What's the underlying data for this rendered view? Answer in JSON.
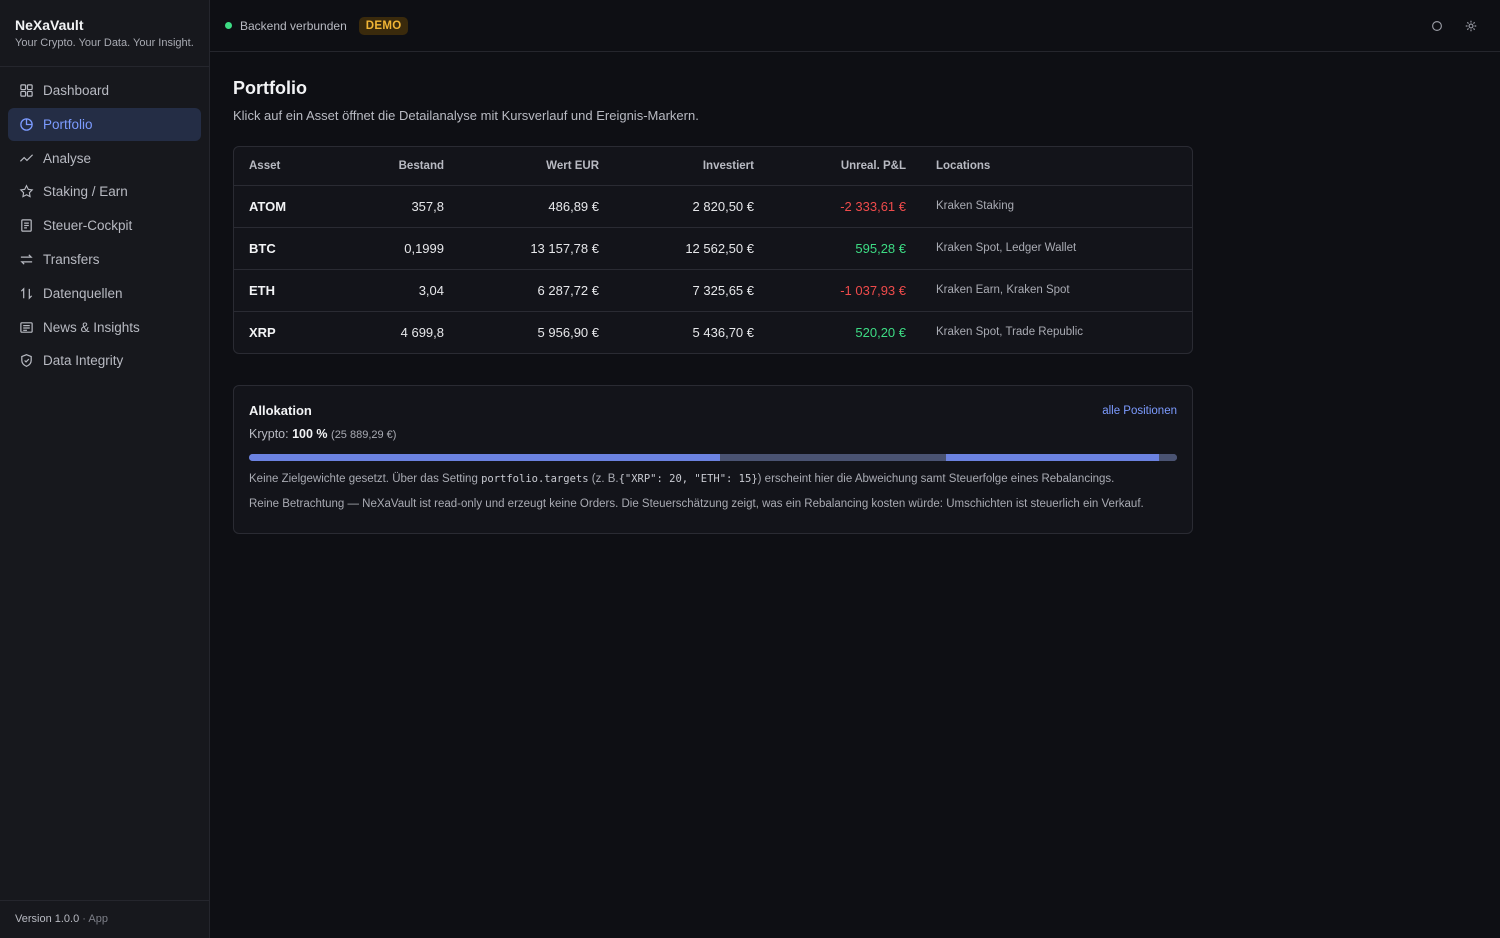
{
  "brand": {
    "name": "NeXaVault",
    "tagline": "Your Crypto. Your Data. Your Insight."
  },
  "sidebar": {
    "items": [
      {
        "label": "Dashboard",
        "icon": "grid-icon",
        "active": false
      },
      {
        "label": "Portfolio",
        "icon": "pie-chart-icon",
        "active": true
      },
      {
        "label": "Analyse",
        "icon": "trend-line-icon",
        "active": false
      },
      {
        "label": "Staking / Earn",
        "icon": "star-icon",
        "active": false
      },
      {
        "label": "Steuer-Cockpit",
        "icon": "document-icon",
        "active": false
      },
      {
        "label": "Transfers",
        "icon": "arrows-swap-icon",
        "active": false
      },
      {
        "label": "Datenquellen",
        "icon": "arrows-updown-icon",
        "active": false
      },
      {
        "label": "News & Insights",
        "icon": "newspaper-icon",
        "active": false
      },
      {
        "label": "Data Integrity",
        "icon": "shield-icon",
        "active": false
      }
    ],
    "version_label": "Version 1.0.0",
    "version_sep": "·",
    "version_app": "App"
  },
  "topbar": {
    "status": "Backend verbunden",
    "badge": "DEMO"
  },
  "page": {
    "title": "Portfolio",
    "subtitle": "Klick auf ein Asset öffnet die Detailanalyse mit Kursverlauf und Ereignis-Markern."
  },
  "table": {
    "headers": {
      "asset": "Asset",
      "bestand": "Bestand",
      "wert": "Wert EUR",
      "investiert": "Investiert",
      "pnl": "Unreal. P&L",
      "locations": "Locations"
    },
    "rows": [
      {
        "asset": "ATOM",
        "bestand": "357,8",
        "wert": "486,89 €",
        "investiert": "2 820,50 €",
        "pnl": "-2 333,61 €",
        "pnl_sign": "neg",
        "locations": "Kraken Staking"
      },
      {
        "asset": "BTC",
        "bestand": "0,1999",
        "wert": "13 157,78 €",
        "investiert": "12 562,50 €",
        "pnl": "595,28 €",
        "pnl_sign": "pos",
        "locations": "Kraken Spot, Ledger Wallet"
      },
      {
        "asset": "ETH",
        "bestand": "3,04",
        "wert": "6 287,72 €",
        "investiert": "7 325,65 €",
        "pnl": "-1 037,93 €",
        "pnl_sign": "neg",
        "locations": "Kraken Earn, Kraken Spot"
      },
      {
        "asset": "XRP",
        "bestand": "4 699,8",
        "wert": "5 956,90 €",
        "investiert": "5 436,70 €",
        "pnl": "520,20 €",
        "pnl_sign": "pos",
        "locations": "Kraken Spot, Trade Republic"
      }
    ]
  },
  "allocation": {
    "title": "Allokation",
    "link": "alle Positionen",
    "label": "Krypto:",
    "percent": "100 %",
    "total": "(25 889,29 €)",
    "bar_segments": [
      {
        "fraction": 0.508,
        "color": "#6b82e0"
      },
      {
        "fraction": 0.243,
        "color": "#4a5372"
      },
      {
        "fraction": 0.23,
        "color": "#6b82e0"
      },
      {
        "fraction": 0.019,
        "color": "#4a5372"
      }
    ],
    "note1_pre": "Keine Zielgewichte gesetzt. Über das Setting",
    "note1_code": "portfolio.targets",
    "note1_mid": "(z. B.",
    "note1_code2": "{\"XRP\": 20, \"ETH\": 15}",
    "note1_post": ") erscheint hier die Abweichung samt Steuerfolge eines Rebalancings.",
    "note2": "Reine Betrachtung — NeXaVault ist read-only und erzeugt keine Orders. Die Steuerschätzung zeigt, was ein Rebalancing kosten würde: Umschichten ist steuerlich ein Verkauf."
  },
  "colors": {
    "accent": "#7c9bff",
    "positive": "#3ddc84",
    "negative": "#ef4b4b",
    "badge": "#f1b536"
  }
}
